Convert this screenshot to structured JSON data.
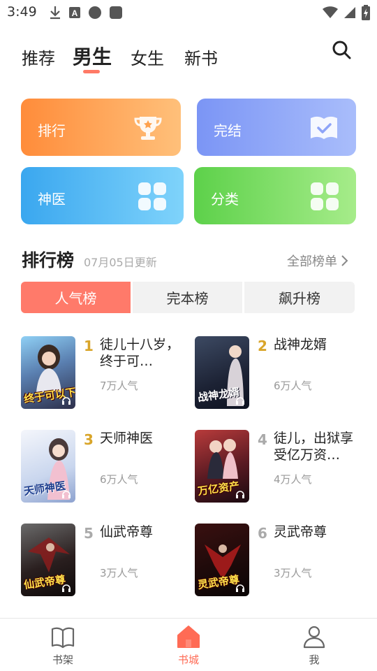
{
  "status_bar": {
    "time": "3:49",
    "icons": [
      "download-icon",
      "font-icon",
      "circle-icon",
      "square-icon"
    ],
    "right_icons": [
      "wifi-icon",
      "signal-icon",
      "battery-icon"
    ]
  },
  "top_tabs": {
    "items": [
      {
        "label": "推荐"
      },
      {
        "label": "男生"
      },
      {
        "label": "女生"
      },
      {
        "label": "新书"
      }
    ],
    "active_index": 1
  },
  "cards": [
    {
      "label": "排行",
      "icon": "trophy-icon"
    },
    {
      "label": "完结",
      "icon": "book-check-icon"
    },
    {
      "label": "神医",
      "icon": "grid-icon"
    },
    {
      "label": "分类",
      "icon": "grid-icon"
    }
  ],
  "ranking": {
    "title": "排行榜",
    "date": "07月05日更新",
    "all_label": "全部榜单",
    "tabs": [
      {
        "label": "人气榜"
      },
      {
        "label": "完本榜"
      },
      {
        "label": "飙升榜"
      }
    ],
    "books": [
      {
        "rank": "1",
        "title": "徒儿十八岁，终于可…",
        "popularity": "7万人气",
        "cover_text": "终于可以下山"
      },
      {
        "rank": "2",
        "title": "战神龙婿",
        "popularity": "6万人气",
        "cover_text": "战神龙婿"
      },
      {
        "rank": "3",
        "title": "天师神医",
        "popularity": "6万人气",
        "cover_text": "天师神医"
      },
      {
        "rank": "4",
        "title": "徒儿，出狱享受亿万资…",
        "popularity": "4万人气",
        "cover_text": "万亿资产"
      },
      {
        "rank": "5",
        "title": "仙武帝尊",
        "popularity": "3万人气",
        "cover_text": "仙武帝尊"
      },
      {
        "rank": "6",
        "title": "灵武帝尊",
        "popularity": "3万人气",
        "cover_text": "灵武帝尊"
      }
    ]
  },
  "bottom_nav": {
    "items": [
      {
        "label": "书架",
        "icon": "bookshelf-icon"
      },
      {
        "label": "书城",
        "icon": "home-icon"
      },
      {
        "label": "我",
        "icon": "profile-icon"
      }
    ],
    "active_index": 1
  },
  "colors": {
    "accent": "#ff7a6a",
    "rank_gold": "#d9a52a",
    "rank_gray": "#aaaaaa"
  }
}
